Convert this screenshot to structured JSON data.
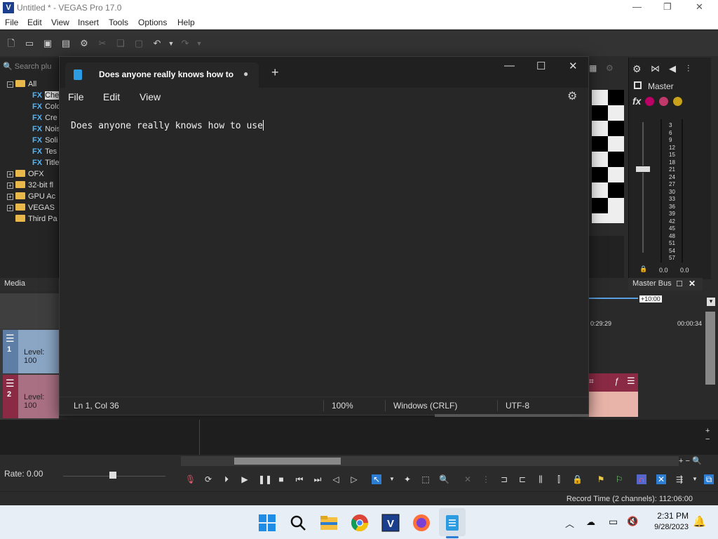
{
  "vegas": {
    "title": "Untitled * - VEGAS Pro 17.0",
    "logo": "V",
    "menu": [
      "File",
      "Edit",
      "View",
      "Insert",
      "Tools",
      "Options",
      "Help"
    ],
    "search_placeholder": "Search plu",
    "tree": {
      "all": "All",
      "fx_items": [
        "Che",
        "Colo",
        "Cre",
        "Nois",
        "Soli",
        "Tes",
        "Title"
      ],
      "fx_label": "FX",
      "folders": [
        "OFX",
        "32-bit fl",
        "GPU Ac",
        "VEGAS",
        "Third Pa"
      ]
    },
    "media_tab": "Media",
    "tracks": [
      {
        "number": "1",
        "level": "Level: 100",
        "color": "#6e87a8"
      },
      {
        "number": "2",
        "level": "Level: 100",
        "color": "#8b2a44"
      }
    ],
    "mixer": {
      "master_label": "Master",
      "fx_label": "fx",
      "meter_ticks": [
        "3",
        "6",
        "9",
        "12",
        "15",
        "18",
        "21",
        "24",
        "27",
        "30",
        "33",
        "36",
        "39",
        "42",
        "45",
        "48",
        "51",
        "54",
        "57"
      ],
      "left_value": "0.0",
      "right_value": "0.0",
      "bus_label": "Master Bus"
    },
    "timeline": {
      "offset": "+10:00",
      "time_a": "0:29:29",
      "time_b": "00:00:34"
    },
    "rate": "Rate: 0.00",
    "record_time": "Record Time (2 channels): 112:06:00"
  },
  "notepad": {
    "tab_title": "Does anyone really knows how to u",
    "new_tab": "+",
    "menu": [
      "File",
      "Edit",
      "View"
    ],
    "content": "Does anyone really knows how to use",
    "status": {
      "position": "Ln 1, Col 36",
      "zoom": "100%",
      "line_ending": "Windows (CRLF)",
      "encoding": "UTF-8"
    }
  },
  "taskbar": {
    "time": "2:31 PM",
    "date": "9/28/2023"
  }
}
